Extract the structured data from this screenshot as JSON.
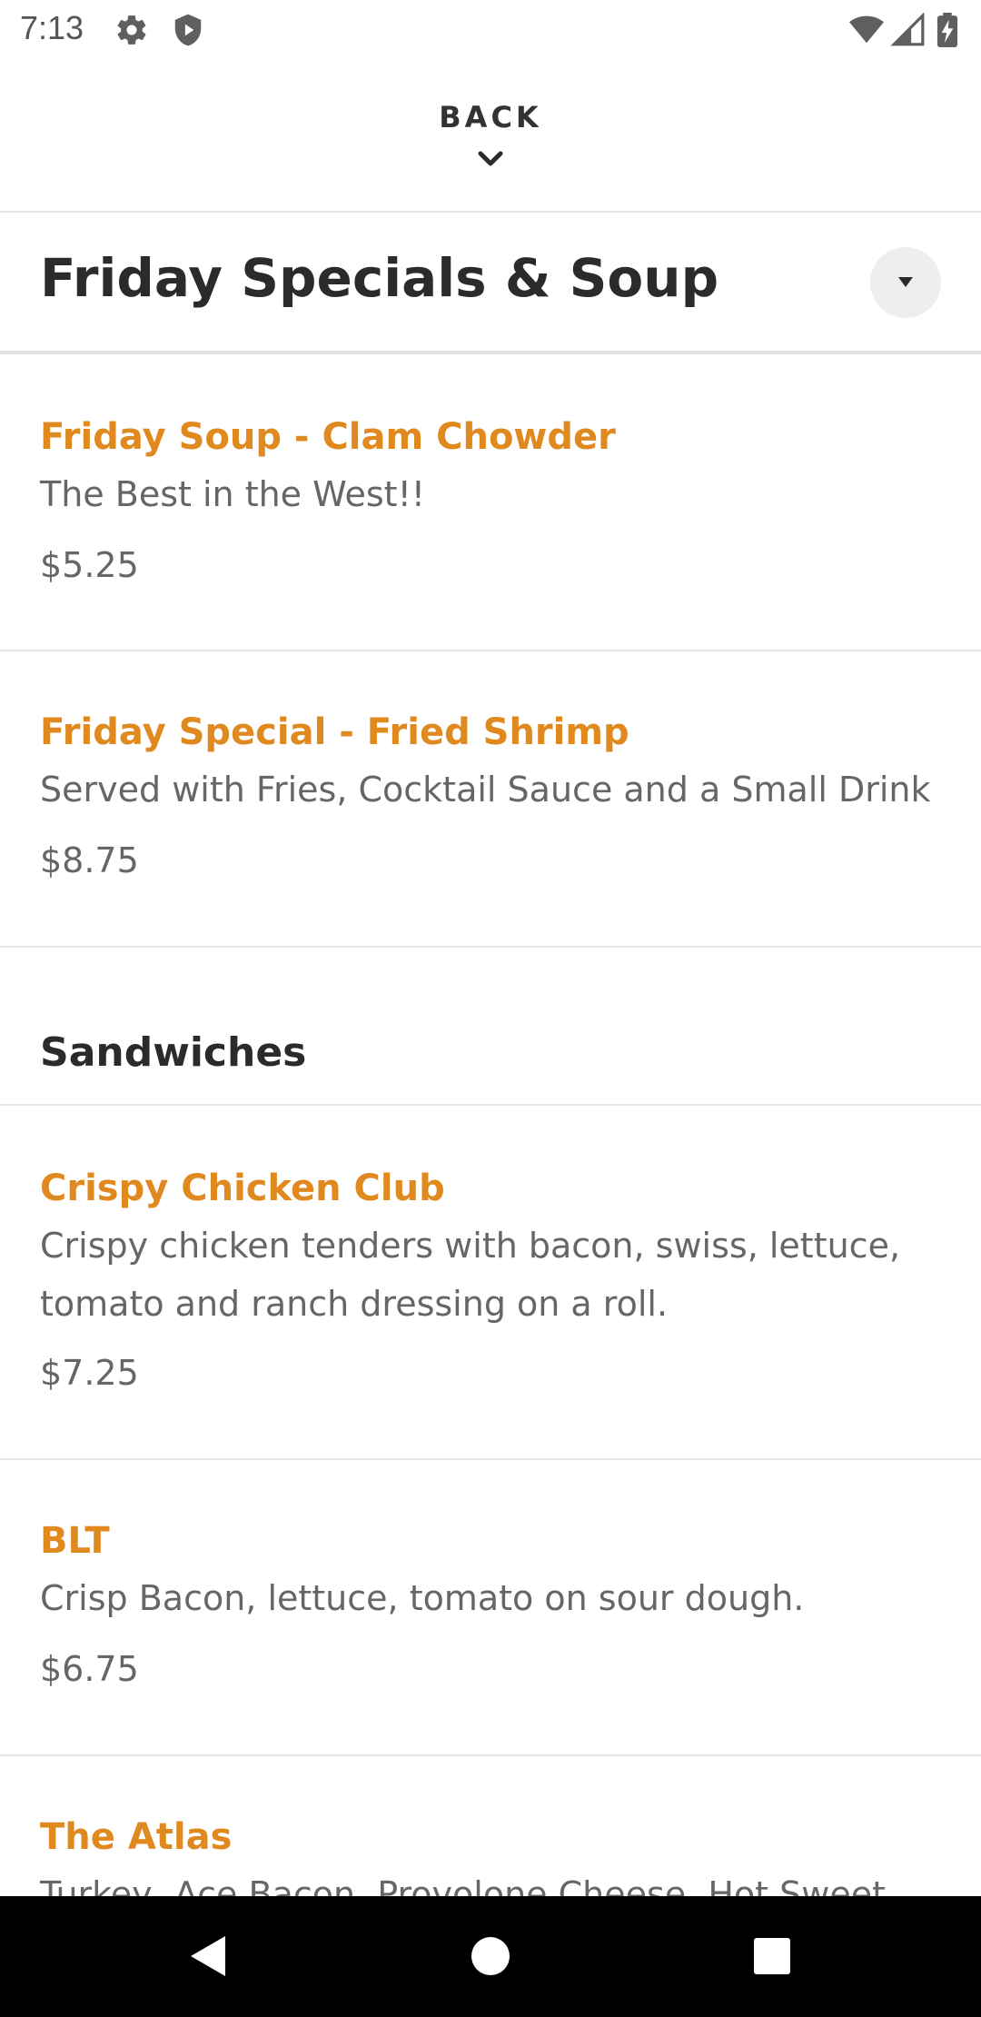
{
  "status_bar": {
    "time": "7:13",
    "left_icons": [
      "gear-icon",
      "shield-icon"
    ],
    "right_icons": [
      "wifi-icon",
      "signal-icon",
      "battery-icon"
    ]
  },
  "header": {
    "back_label": "BACK",
    "back_icon": "chevron-down-icon"
  },
  "category": {
    "title": "Friday Specials & Soup",
    "dropdown_icon": "caret-down-icon"
  },
  "menu": {
    "items": [
      {
        "name": "Friday Soup - Clam Chowder",
        "description": "The Best in the West!!",
        "price": "$5.25"
      },
      {
        "name": "Friday Special - Fried Shrimp",
        "description": "Served with Fries, Cocktail Sauce and a Small Drink",
        "price": "$8.75"
      }
    ],
    "sections": [
      {
        "title": "Sandwiches",
        "items": [
          {
            "name": "Crispy Chicken Club",
            "description": "Crispy chicken tenders with bacon, swiss, lettuce, tomato and ranch dressing on a roll.",
            "price": "$7.25"
          },
          {
            "name": "BLT",
            "description": "Crisp Bacon, lettuce, tomato on sour dough.",
            "price": "$6.75"
          },
          {
            "name": "The Atlas",
            "description": "Turkey, Ace Bacon, Provolone Cheese, Hot Sweet"
          }
        ]
      }
    ]
  },
  "colors": {
    "accent": "#e0891e",
    "title_text": "#2b2b2b",
    "body_text": "#666666",
    "divider": "#e6e6e6",
    "nav_bar": "#000000"
  },
  "nav_bar": {
    "icons": [
      "back-triangle-icon",
      "home-circle-icon",
      "recents-square-icon"
    ]
  }
}
